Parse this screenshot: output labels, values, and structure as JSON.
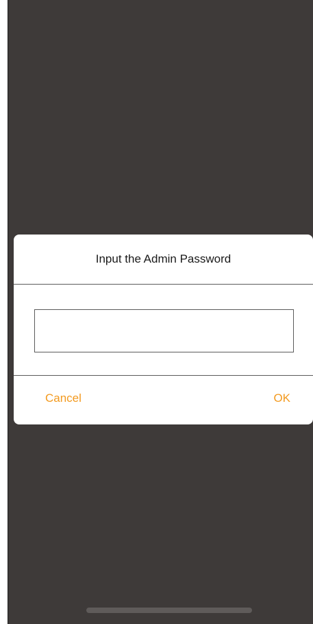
{
  "dialog": {
    "title": "Input the Admin Password",
    "password_value": "",
    "password_placeholder": "",
    "cancel_label": "Cancel",
    "ok_label": "OK"
  },
  "colors": {
    "backdrop": "#3e3a39",
    "accent": "#f39a1f",
    "dialog_bg": "#ffffff"
  }
}
